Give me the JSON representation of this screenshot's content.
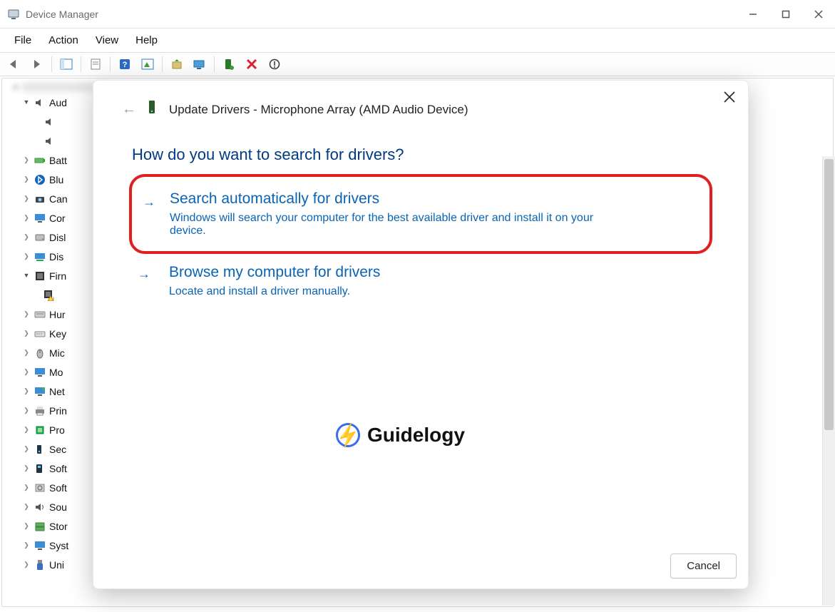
{
  "window": {
    "title": "Device Manager"
  },
  "menubar": [
    "File",
    "Action",
    "View",
    "Help"
  ],
  "toolbar_icons": [
    "back-arrow-icon",
    "forward-arrow-icon",
    "|",
    "show-hide-console-tree-icon",
    "|",
    "properties-sheet-icon",
    "|",
    "help-icon",
    "action-center-icon",
    "|",
    "update-driver-icon",
    "scan-hardware-icon",
    "|",
    "enable-device-icon",
    "disable-device-icon",
    "uninstall-device-icon"
  ],
  "tree": {
    "root_expanded": true,
    "second_row_label": "Aud",
    "second_row_children": [
      "",
      ""
    ],
    "nodes": [
      {
        "label": "Batt",
        "icon": "battery"
      },
      {
        "label": "Blu",
        "icon": "bluetooth"
      },
      {
        "label": "Can",
        "icon": "camera"
      },
      {
        "label": "Cor",
        "icon": "monitor"
      },
      {
        "label": "Disl",
        "icon": "disk"
      },
      {
        "label": "Dis",
        "icon": "display-adapter"
      },
      {
        "label": "Firn",
        "icon": "firmware",
        "expanded": true,
        "children": [
          {
            "label": "",
            "icon": "firmware-warn"
          }
        ]
      },
      {
        "label": "Hur",
        "icon": "keyboard-hid"
      },
      {
        "label": "Key",
        "icon": "keyboard"
      },
      {
        "label": "Mic",
        "icon": "mouse"
      },
      {
        "label": "Mo",
        "icon": "monitor"
      },
      {
        "label": "Net",
        "icon": "network"
      },
      {
        "label": "Prin",
        "icon": "printer"
      },
      {
        "label": "Pro",
        "icon": "processor"
      },
      {
        "label": "Sec",
        "icon": "security"
      },
      {
        "label": "Soft",
        "icon": "software-component"
      },
      {
        "label": "Soft",
        "icon": "software-device"
      },
      {
        "label": "Sou",
        "icon": "sound"
      },
      {
        "label": "Stor",
        "icon": "storage"
      },
      {
        "label": "Syst",
        "icon": "system"
      },
      {
        "label": "Uni",
        "icon": "usb"
      }
    ]
  },
  "modal": {
    "title": "Update Drivers - Microphone Array (AMD Audio Device)",
    "question": "How do you want to search for drivers?",
    "option1_title": "Search automatically for drivers",
    "option1_desc": "Windows will search your computer for the best available driver and install it on your device.",
    "option2_title": "Browse my computer for drivers",
    "option2_desc": "Locate and install a driver manually.",
    "cancel": "Cancel"
  },
  "watermark": "Guidelogy"
}
